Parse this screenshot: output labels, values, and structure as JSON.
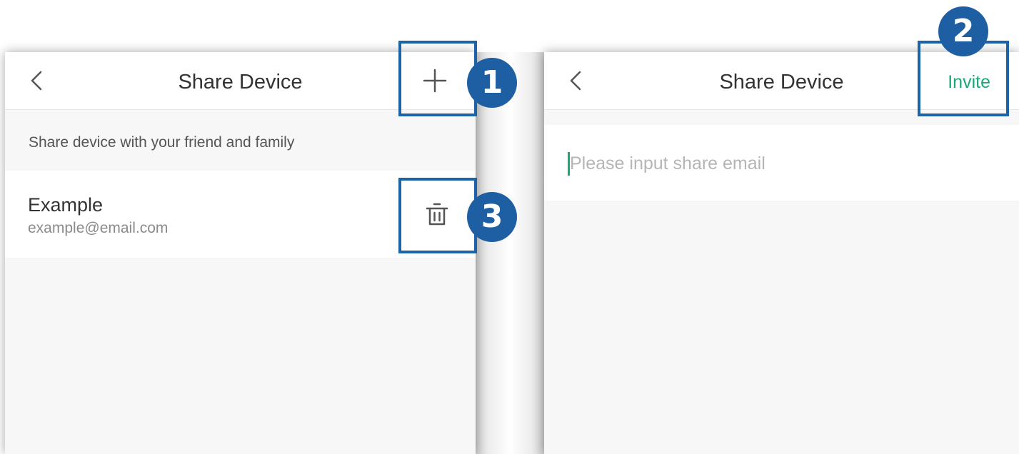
{
  "left_screen": {
    "title": "Share Device",
    "subtitle": "Share device with your friend and family",
    "members": [
      {
        "name": "Example",
        "email": "example@email.com"
      }
    ],
    "icons": {
      "back": "chevron-left-icon",
      "add": "plus-icon",
      "delete": "trash-icon"
    }
  },
  "right_screen": {
    "title": "Share Device",
    "invite_label": "Invite",
    "email_input": {
      "value": "",
      "placeholder": "Please input share email"
    }
  },
  "annotations": [
    {
      "number": "1",
      "target": "add-button"
    },
    {
      "number": "2",
      "target": "invite-button"
    },
    {
      "number": "3",
      "target": "delete-button"
    }
  ],
  "colors": {
    "accent": "#1aa877",
    "callout": "#1c63a8",
    "badge": "#1e5fa3",
    "panel_bg": "#f7f7f7"
  }
}
